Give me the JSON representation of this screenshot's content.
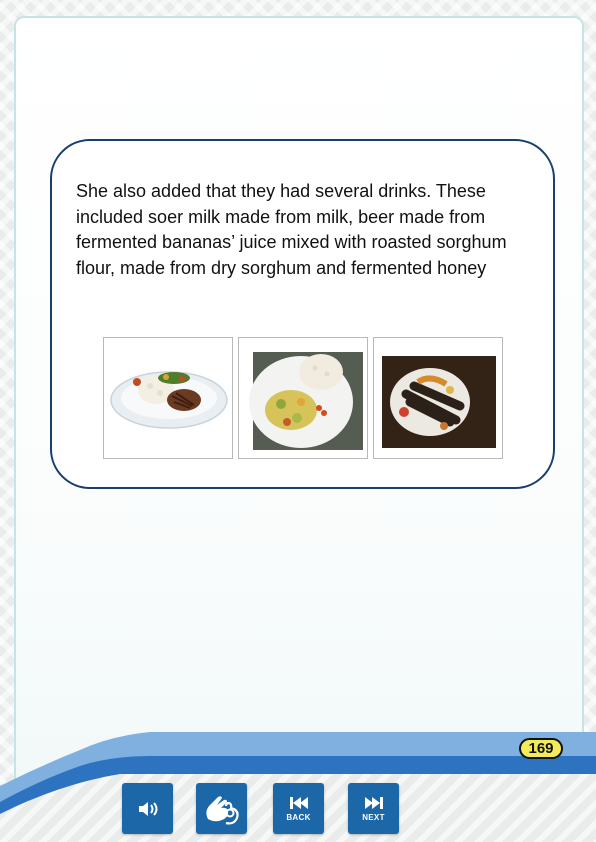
{
  "story": {
    "text": "She also added that they had several drinks. These included soer milk made from milk, beer made from fermented bananas’ juice mixed with roasted sorghum flour, made from dry sorghum and fermented honey"
  },
  "images": [
    {
      "name": "rice-meat-plate-image"
    },
    {
      "name": "rice-vegetable-plate-image"
    },
    {
      "name": "fish-plate-image"
    }
  ],
  "page": {
    "number": "169"
  },
  "controls": {
    "audio_icon": "speaker-icon",
    "sign_icon": "sign-language-icon",
    "back_label": "BACK",
    "next_label": "NEXT"
  },
  "colors": {
    "accent": "#1b67a8",
    "box_border": "#173e6c",
    "band_light": "#7fb0e0",
    "badge": "#f3ec5a"
  }
}
